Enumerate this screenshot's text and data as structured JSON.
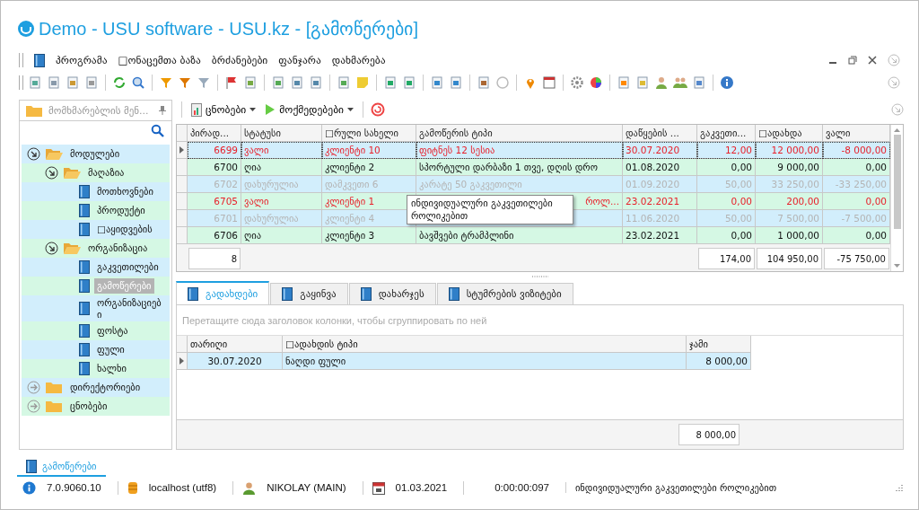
{
  "window": {
    "title": "Demo - USU software - USU.kz - [გამოწერები]"
  },
  "menu": [
    "პროგრამა",
    "□ონაცემთა ბაზა",
    "ბრძანებები",
    "ფანჯარა",
    "დახმარება"
  ],
  "sidebar": {
    "title": "მომხმარებლის მენ...",
    "tree": [
      {
        "label": "მოდულები",
        "kind": "folder",
        "expanded": true,
        "selected": false,
        "children": [
          {
            "label": "მაღაზია",
            "kind": "folder",
            "expanded": true,
            "selected": false,
            "children": [
              {
                "label": "მოთხოვნები",
                "kind": "doc",
                "selected": false
              },
              {
                "label": "პროდუქტი",
                "kind": "doc",
                "selected": false
              },
              {
                "label": "□აყიდვების",
                "kind": "doc",
                "selected": false
              }
            ]
          },
          {
            "label": "ორგანიზაცია",
            "kind": "folder",
            "expanded": true,
            "selected": false,
            "children": [
              {
                "label": "გაკვეთილები",
                "kind": "doc",
                "selected": false
              },
              {
                "label": "გამოწერები",
                "kind": "doc",
                "selected": true
              },
              {
                "label": "ორგანიზაციებ ი",
                "kind": "doc",
                "selected": false
              },
              {
                "label": "ფოსტა",
                "kind": "doc",
                "selected": false
              },
              {
                "label": "ფული",
                "kind": "doc",
                "selected": false
              },
              {
                "label": "ხალხი",
                "kind": "doc",
                "selected": false
              }
            ]
          }
        ]
      },
      {
        "label": "დირექტორიები",
        "kind": "folder",
        "expanded": false,
        "selected": false
      },
      {
        "label": "ცნობები",
        "kind": "folder",
        "expanded": false,
        "selected": false
      }
    ]
  },
  "actions": [
    "ცნობები",
    "მოქმედებები"
  ],
  "grid": {
    "columns": [
      "პირად...",
      "სტატუსი",
      "□რული სახელი",
      "გამოწერის ტიპი",
      "დაწყების ...",
      "გაკვეთი...",
      "□ადახდა",
      "ვალი"
    ],
    "rows": [
      {
        "id": "6699",
        "status": "ვალი",
        "name": "კლიენტი 10",
        "type": "ფიტნეს 12 სესია",
        "start": "30.07.2020",
        "lessons": "12,00",
        "paid": "12 000,00",
        "debt": "-8 000,00",
        "kind": "debt",
        "selected": true
      },
      {
        "id": "6700",
        "status": "ღია",
        "name": "კლიენტი 2",
        "type": "სპორტული დარბაზი 1 თვე, დღის დრო",
        "start": "01.08.2020",
        "lessons": "0,00",
        "paid": "9 000,00",
        "debt": "0,00",
        "kind": "open",
        "selected": false
      },
      {
        "id": "6702",
        "status": "დახურულია",
        "name": "დამკვეთი 6",
        "type": "კარატე 50 გაკვეთილი",
        "start": "01.09.2020",
        "lessons": "50,00",
        "paid": "33 250,00",
        "debt": "-33 250,00",
        "kind": "closed",
        "selected": false
      },
      {
        "id": "6705",
        "status": "ვალი",
        "name": "კლიენტი 1",
        "type": "როლ...",
        "tooltip": "ინდივიდუალური გაკვეთილები როლიკებით",
        "start": "23.02.2021",
        "lessons": "0,00",
        "paid": "200,00",
        "debt": "0,00",
        "kind": "debt",
        "selected": false
      },
      {
        "id": "6701",
        "status": "დახურულია",
        "name": "კლიენტი 4",
        "start": "11.06.2020",
        "lessons": "50,00",
        "paid": "7 500,00",
        "debt": "-7 500,00",
        "kind": "closed",
        "selected": false
      },
      {
        "id": "6706",
        "status": "ღია",
        "name": "კლიენტი 3",
        "type": "ბავშვები ტრამპლინი",
        "start": "23.02.2021",
        "lessons": "0,00",
        "paid": "1 000,00",
        "debt": "0,00",
        "kind": "open",
        "selected": false
      }
    ],
    "totals": {
      "count": "8",
      "lessons": "174,00",
      "paid": "104 950,00",
      "debt": "-75 750,00"
    }
  },
  "detail_tabs": [
    {
      "label": "გადახდები",
      "selected": true
    },
    {
      "label": "გაყინვა",
      "selected": false
    },
    {
      "label": "დახარჯეს",
      "selected": false
    },
    {
      "label": "სტუმრების ვიზიტები",
      "selected": false
    }
  ],
  "detail": {
    "group_hint": "Перетащите сюда заголовок колонки, чтобы сгруппировать по ней",
    "columns": [
      "თარიღი",
      "□ადახდის ტიპი",
      "ჯამი"
    ],
    "rows": [
      {
        "date": "30.07.2020",
        "type": "ნაღდი ფული",
        "amount": "8 000,00",
        "selected": true
      }
    ],
    "total": "8 000,00"
  },
  "document_tabs": [
    {
      "label": "გამოწერები",
      "selected": true
    }
  ],
  "status_bar": {
    "version": "7.0.9060.10",
    "database": "localhost (utf8)",
    "user": "NIKOLAY (MAIN)",
    "date": "01.03.2021",
    "elapsed": "0:00:00:097",
    "message": "ინდივიდუალური გაკვეთილები როლიკებით"
  }
}
